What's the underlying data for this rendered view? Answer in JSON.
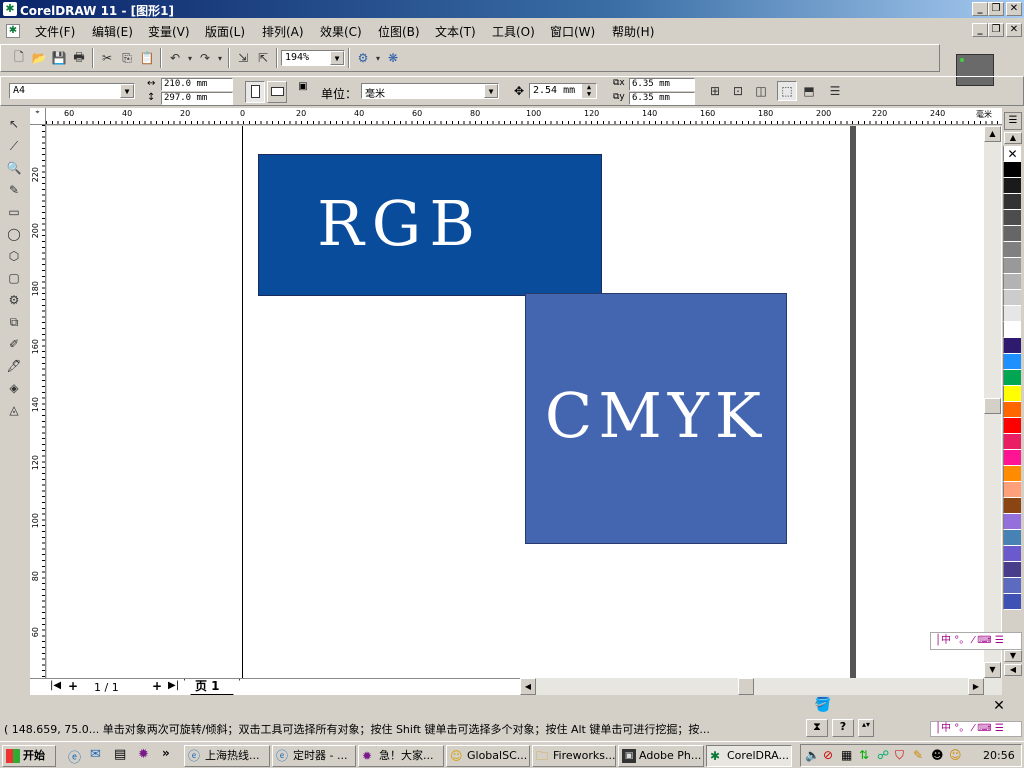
{
  "app": {
    "title": "CorelDRAW 11 - [图形1]"
  },
  "menu": [
    "文件(F)",
    "编辑(E)",
    "变量(V)",
    "版面(L)",
    "排列(A)",
    "效果(C)",
    "位图(B)",
    "文本(T)",
    "工具(O)",
    "窗口(W)",
    "帮助(H)"
  ],
  "toolbar": {
    "zoom": "194%"
  },
  "property_bar": {
    "paper": "A4",
    "width": "210.0 mm",
    "height": "297.0 mm",
    "unit_label": "单位：",
    "unit": "毫米",
    "nudge": "2.54 mm",
    "dup_x": "6.35 mm",
    "dup_y": "6.35 mm"
  },
  "ruler": {
    "unit": "毫米",
    "h_ticks": [
      "60",
      "40",
      "20",
      "0",
      "20",
      "40",
      "60",
      "80",
      "100",
      "120",
      "140",
      "160",
      "180",
      "200",
      "220",
      "240"
    ],
    "v_ticks": [
      "220",
      "200",
      "180",
      "160",
      "140",
      "120",
      "100",
      "80",
      "60"
    ]
  },
  "canvas": {
    "rgb_text": "RGB",
    "cmyk_text": "CMYK",
    "rgb_color": "#0a4c9c",
    "cmyk_color": "#4466b0"
  },
  "page_nav": {
    "counter": "1 / 1",
    "tab": "页 1"
  },
  "status": {
    "text": "( 148.659, 75.0... 单击对象两次可旋转/倾斜；双击工具可选择所有对象；按住 Shift 键单击可选择多个对象；按住 Alt 键单击可进行挖掘；按..."
  },
  "palette": [
    "#ffffff",
    "#000000",
    "#1a1a1a",
    "#333333",
    "#4d4d4d",
    "#666666",
    "#808080",
    "#999999",
    "#b3b3b3",
    "#cccccc",
    "#e6e6e6",
    "#ffffff",
    "#2e1a6e",
    "#1e90ff",
    "#00a651",
    "#ffff00",
    "#ff6600",
    "#ff0000",
    "#e91e63",
    "#ff1493",
    "#ff8c00",
    "#ffa07a",
    "#8b4513",
    "#9370db",
    "#4682b4",
    "#6a5acd",
    "#483d8b",
    "#5c6bc0",
    "#3f51b5"
  ],
  "taskbar": {
    "start": "开始",
    "tasks": [
      "上海热线...",
      "定时器 - ...",
      "急！大家...",
      "GlobalSC...",
      "Fireworks...",
      "Adobe Ph...",
      "CorelDRA..."
    ],
    "clock": "20:56"
  }
}
